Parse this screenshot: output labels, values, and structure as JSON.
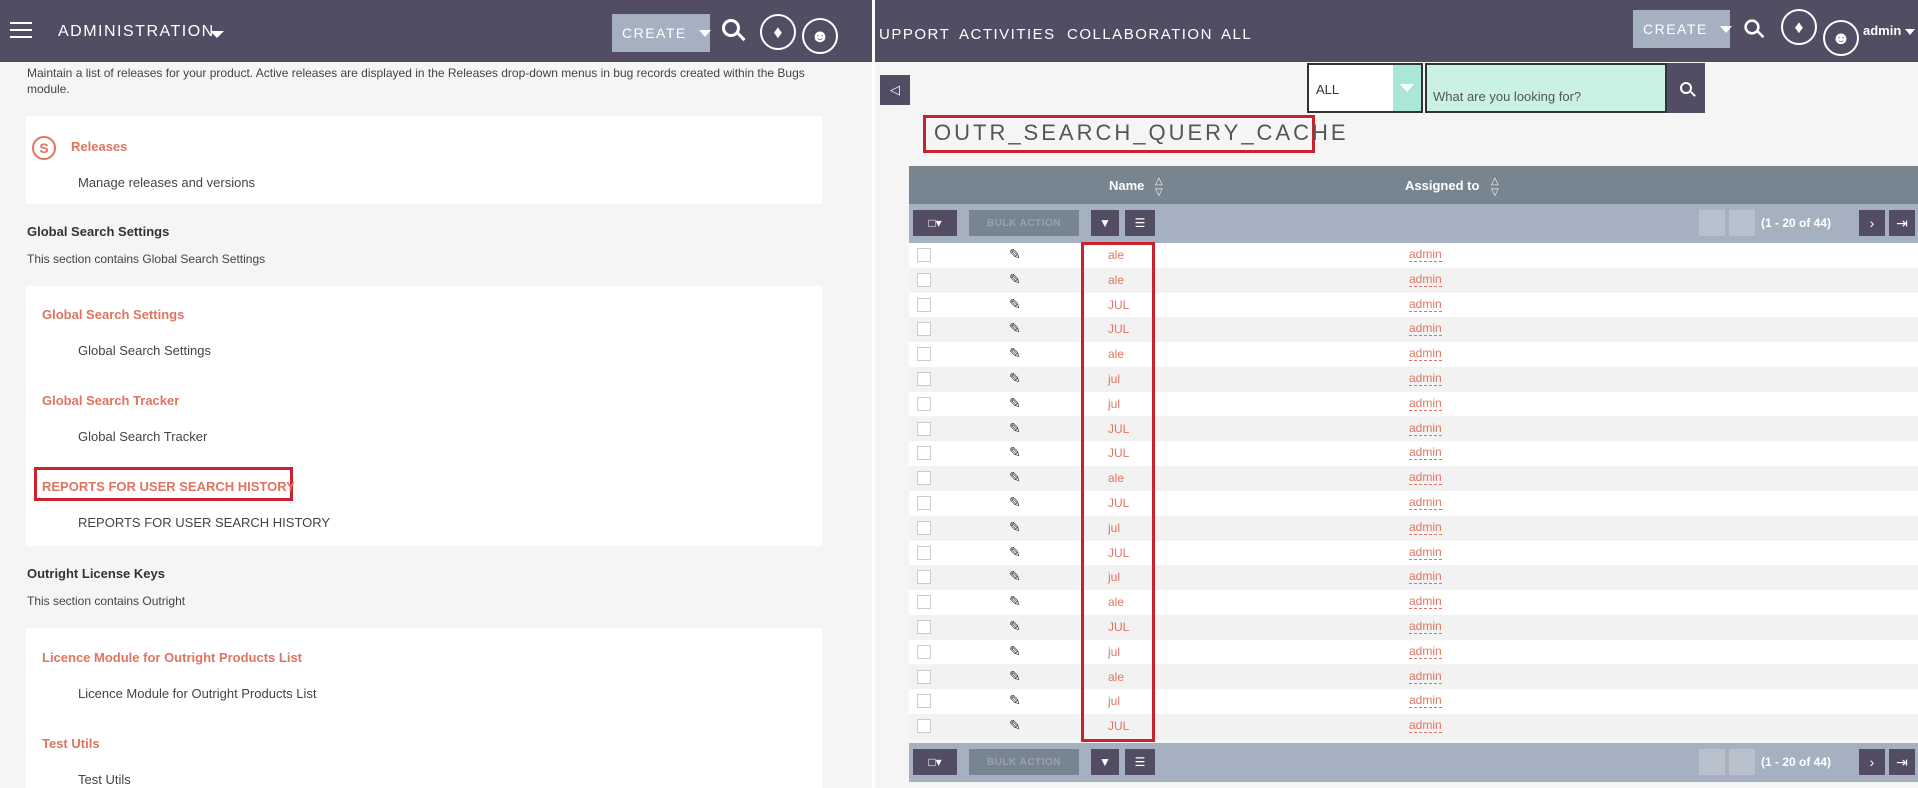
{
  "left": {
    "topbar": {
      "module_title": "ADMINISTRATION",
      "create_label": "CREATE"
    },
    "intro_text": "Maintain a list of releases for your product. Active releases are displayed in the Releases drop-down menus in bug records created within the Bugs module.",
    "releases": {
      "link": "Releases",
      "desc": "Manage releases and versions"
    },
    "global_search_section": {
      "title": "Global Search Settings",
      "desc": "This section contains Global Search Settings",
      "items": [
        {
          "link": "Global Search Settings",
          "desc": "Global Search Settings"
        },
        {
          "link": "Global Search Tracker",
          "desc": "Global Search Tracker"
        },
        {
          "link": "REPORTS FOR USER SEARCH HISTORY",
          "desc": "REPORTS FOR USER SEARCH HISTORY"
        }
      ]
    },
    "license_section": {
      "title": "Outright License Keys",
      "desc": "This section contains Outright",
      "items": [
        {
          "link": "Licence Module for Outright Products List",
          "desc": "Licence Module for Outright Products List"
        },
        {
          "link": "Test Utils",
          "desc": "Test Utils"
        }
      ]
    }
  },
  "right": {
    "topbar": {
      "nav": [
        "UPPORT",
        "ACTIVITIES",
        "COLLABORATION",
        "ALL"
      ],
      "create_label": "CREATE",
      "user_label": "admin"
    },
    "filter": {
      "selected": "ALL"
    },
    "search": {
      "placeholder": "What are you looking for?"
    },
    "module_heading": "OUTR_SEARCH_QUERY_CACHE",
    "columns": {
      "name": "Name",
      "assigned": "Assigned to"
    },
    "bulk_action": "BULK ACTION",
    "pagination": "(1 - 20 of 44)",
    "rows": [
      {
        "name": "ale",
        "assigned": "admin"
      },
      {
        "name": "ale",
        "assigned": "admin"
      },
      {
        "name": "JUL",
        "assigned": "admin"
      },
      {
        "name": "JUL",
        "assigned": "admin"
      },
      {
        "name": "ale",
        "assigned": "admin"
      },
      {
        "name": "jul",
        "assigned": "admin"
      },
      {
        "name": "jul",
        "assigned": "admin"
      },
      {
        "name": "JUL",
        "assigned": "admin"
      },
      {
        "name": "JUL",
        "assigned": "admin"
      },
      {
        "name": "ale",
        "assigned": "admin"
      },
      {
        "name": "JUL",
        "assigned": "admin"
      },
      {
        "name": "jul",
        "assigned": "admin"
      },
      {
        "name": "JUL",
        "assigned": "admin"
      },
      {
        "name": "jul",
        "assigned": "admin"
      },
      {
        "name": "ale",
        "assigned": "admin"
      },
      {
        "name": "JUL",
        "assigned": "admin"
      },
      {
        "name": "jul",
        "assigned": "admin"
      },
      {
        "name": "ale",
        "assigned": "admin"
      },
      {
        "name": "jul",
        "assigned": "admin"
      },
      {
        "name": "JUL",
        "assigned": "admin"
      }
    ],
    "colors": {
      "topbar": "#534d64",
      "link": "#e07462",
      "highlight": "#c9222e",
      "list_header": "#778591",
      "toolbar": "#a5b0c0"
    }
  }
}
